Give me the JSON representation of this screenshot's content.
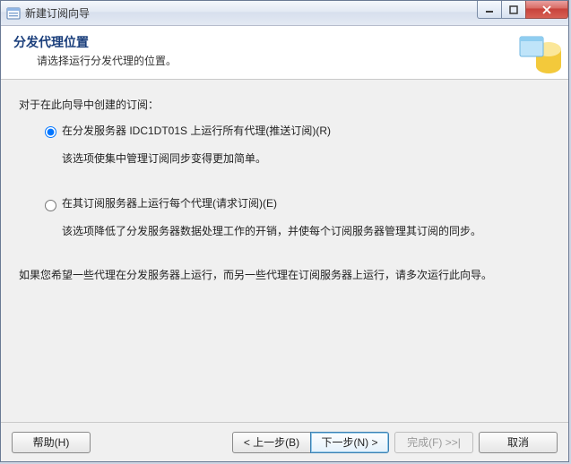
{
  "window": {
    "title": "新建订阅向导"
  },
  "header": {
    "title": "分发代理位置",
    "subtitle": "请选择运行分发代理的位置。"
  },
  "content": {
    "intro": "对于在此向导中创建的订阅：",
    "option1": {
      "label": "在分发服务器 IDC1DT01S 上运行所有代理(推送订阅)(R)",
      "desc": "该选项使集中管理订阅同步变得更加简单。",
      "checked": true
    },
    "option2": {
      "label": "在其订阅服务器上运行每个代理(请求订阅)(E)",
      "desc": "该选项降低了分发服务器数据处理工作的开销，并使每个订阅服务器管理其订阅的同步。",
      "checked": false
    },
    "note": "如果您希望一些代理在分发服务器上运行，而另一些代理在订阅服务器上运行，请多次运行此向导。"
  },
  "footer": {
    "help": "帮助(H)",
    "back": "< 上一步(B)",
    "next": "下一步(N) >",
    "finish": "完成(F) >>|",
    "cancel": "取消"
  }
}
